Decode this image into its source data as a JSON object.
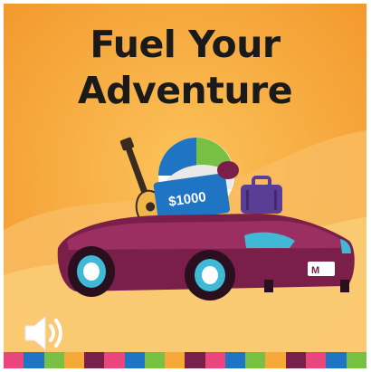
{
  "title": {
    "line1": "Fuel Your",
    "line2": "Adventure"
  },
  "card": {
    "amount": "$1000"
  },
  "colors": {
    "background": "#f6a83a",
    "car": "#7a1f4a",
    "card": "#1f74c4",
    "stripe": [
      "#e8467c",
      "#1f74c4",
      "#77c043",
      "#f6a83a",
      "#7a1f4a",
      "#e8467c",
      "#1f74c4",
      "#77c043",
      "#f6a83a",
      "#7a1f4a",
      "#e8467c",
      "#1f74c4",
      "#77c043",
      "#f6a83a",
      "#7a1f4a",
      "#e8467c",
      "#1f74c4",
      "#77c043"
    ]
  },
  "icons": {
    "audio": "speaker-icon",
    "logo": "brand-logo-icon"
  }
}
